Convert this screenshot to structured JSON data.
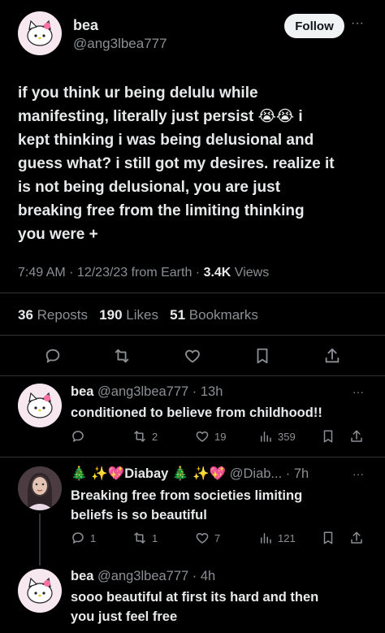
{
  "main_tweet": {
    "name": "bea",
    "handle": "@ang3lbea777",
    "follow_label": "Follow",
    "more_label": "···",
    "text_lines": [
      "if you think ur being delulu while",
      "manifesting, literally just persist 😭😭 i",
      "kept thinking i was being delusional and",
      "guess what? i still got my desires. realize it",
      "is not being delusional, you are just",
      "breaking free from the limiting thinking",
      "you were +"
    ],
    "meta_time": "7:49 AM · 12/23/23 from Earth · ",
    "meta_views_count": "3.4K",
    "meta_views_label": " Views",
    "reposts_count": "36",
    "reposts_label": " Reposts",
    "likes_count": "190",
    "likes_label": " Likes",
    "bookmarks_count": "51",
    "bookmarks_label": " Bookmarks"
  },
  "replies": [
    {
      "name": "bea",
      "handle_time": "@ang3lbea777 · 13h",
      "text_lines": [
        "conditioned to believe from childhood!!"
      ],
      "reply_count": "",
      "repost_count": "2",
      "like_count": "19",
      "view_count": "359"
    },
    {
      "name": "🎄 ✨💖Diabay 🎄 ✨💖",
      "handle_time": "@Diab... · 7h",
      "text_lines": [
        "Breaking free from societies limiting",
        "beliefs is so beautiful"
      ],
      "reply_count": "1",
      "repost_count": "1",
      "like_count": "7",
      "view_count": "121"
    },
    {
      "name": "bea",
      "handle_time": "@ang3lbea777 · 4h",
      "text_lines": [
        "sooo beautiful at first its hard and then",
        "you just feel free"
      ]
    }
  ],
  "colors": {
    "background": "#000000",
    "text": "#e7e9ea",
    "muted": "#71767b",
    "divider": "#2f3336",
    "follow_bg": "#eff3f4"
  }
}
